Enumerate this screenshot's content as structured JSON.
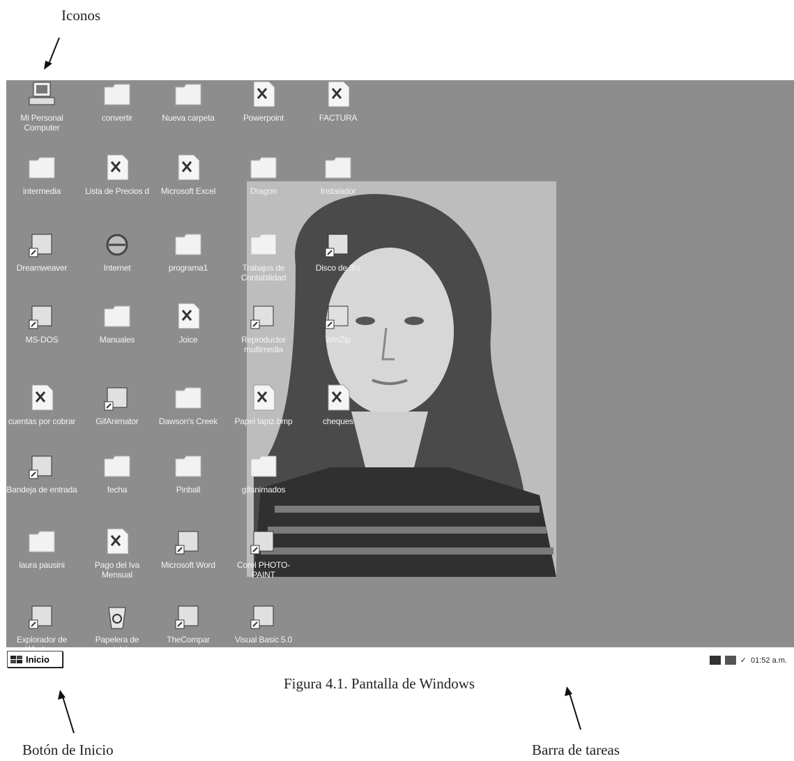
{
  "annotations": {
    "icons_label": "Iconos",
    "start_label": "Botón de Inicio",
    "taskbar_label": "Barra de tareas",
    "caption": "Figura 4.1. Pantalla de Windows"
  },
  "desktop": {
    "icons": [
      {
        "label": "Mi Personal Computer",
        "icon": "computer-icon"
      },
      {
        "label": "intermedia",
        "icon": "folder-icon"
      },
      {
        "label": "Dreamweaver",
        "icon": "shortcut-app-icon"
      },
      {
        "label": "MS-DOS",
        "icon": "msdos-icon"
      },
      {
        "label": "cuentas por cobrar",
        "icon": "excel-file-icon"
      },
      {
        "label": "Bandeja de entrada",
        "icon": "inbox-icon"
      },
      {
        "label": "laura pausini",
        "icon": "folder-icon"
      },
      {
        "label": "Explorador de Windows",
        "icon": "explorer-icon"
      },
      {
        "label": "convertir",
        "icon": "folder-icon"
      },
      {
        "label": "Lista de Precios d",
        "icon": "excel-file-icon"
      },
      {
        "label": "Internet",
        "icon": "internet-explorer-icon"
      },
      {
        "label": "Manuales",
        "icon": "folder-icon"
      },
      {
        "label": "GifAnimator",
        "icon": "shortcut-app-icon"
      },
      {
        "label": "fecha",
        "icon": "folder-icon"
      },
      {
        "label": "Pago del Iva Mensual",
        "icon": "excel-file-icon"
      },
      {
        "label": "Papelera de reciclaje",
        "icon": "recycle-bin-icon"
      },
      {
        "label": "Nueva carpeta",
        "icon": "folder-icon"
      },
      {
        "label": "Microsoft Excel",
        "icon": "excel-shortcut-icon"
      },
      {
        "label": "programa1",
        "icon": "folder-icon"
      },
      {
        "label": "Joice",
        "icon": "document-icon"
      },
      {
        "label": "Dawson's Creek",
        "icon": "folder-icon"
      },
      {
        "label": "Pinball",
        "icon": "folder-icon"
      },
      {
        "label": "Microsoft Word",
        "icon": "word-shortcut-icon"
      },
      {
        "label": "TheCompar",
        "icon": "video-file-icon"
      },
      {
        "label": "Powerpoint",
        "icon": "powerpoint-file-icon"
      },
      {
        "label": "Dragon",
        "icon": "folder-icon"
      },
      {
        "label": "Trabajos de Contabilidad",
        "icon": "folder-icon"
      },
      {
        "label": "Reproductor multimedia",
        "icon": "media-player-icon"
      },
      {
        "label": "Papel tapiz.bmp",
        "icon": "bitmap-file-icon"
      },
      {
        "label": "gifanimados",
        "icon": "folder-icon"
      },
      {
        "label": "Corel PHOTO-PAINT",
        "icon": "corel-icon"
      },
      {
        "label": "Visual Basic 5.0",
        "icon": "visual-basic-icon"
      },
      {
        "label": "FACTURA",
        "icon": "word-file-icon"
      },
      {
        "label": "Instalador",
        "icon": "folder-icon"
      },
      {
        "label": "Disco de 3½",
        "icon": "floppy-shortcut-icon"
      },
      {
        "label": "WinZip",
        "icon": "winzip-icon"
      },
      {
        "label": "cheques",
        "icon": "excel-file-icon"
      }
    ]
  },
  "taskbar": {
    "start_label": "Inicio",
    "clock": "01:52 a.m."
  }
}
